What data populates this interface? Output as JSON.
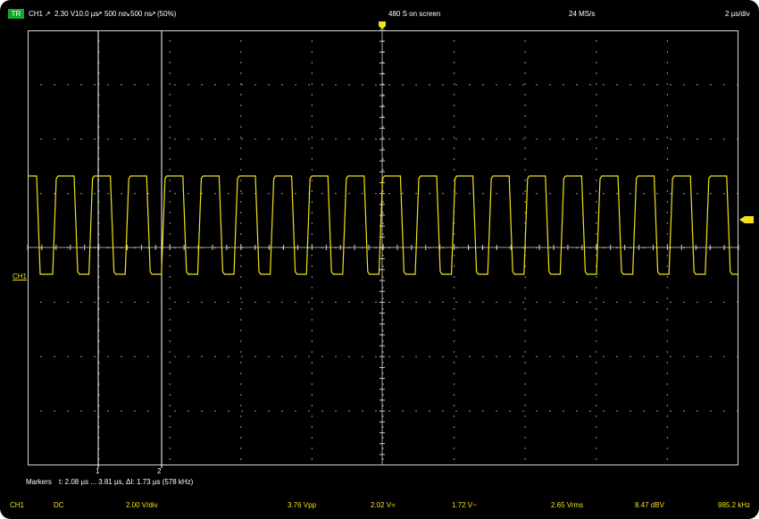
{
  "header": {
    "trigger_badge": "TR",
    "channel": "CH1",
    "trigger_level": "2.30 V",
    "timebase": "10.0 µs",
    "rise_time": "500 ns",
    "fall_time": "500 ns",
    "trigger_position": "(50%)",
    "samples_on_screen": "480 S on screen",
    "sample_rate": "24 MS/s",
    "time_per_div": "2 µs/div"
  },
  "trace": {
    "channel_label": "CH1",
    "color": "#f2e21a",
    "high_level_v": 3.3,
    "low_level_v": -0.45
  },
  "markers": {
    "label": "Markers",
    "readout": "t: 2.08 µs ... 3.81 µs,  ΔI: 1.73 µs (578 kHz)",
    "marker_1_label": "1",
    "marker_2_label": "2",
    "marker_1_time_us": 2.08,
    "marker_2_time_us": 3.81
  },
  "footer": {
    "channel": "CH1",
    "coupling": "DC",
    "volts_per_div": "2.00 V/div",
    "vpp": "3.76 Vpp",
    "v_mean": "2.02 V=",
    "v_ac": "1.72 V~",
    "vrms": "2.65 Vrms",
    "dbv": "8.47 dBV",
    "frequency": "985.2 kHz"
  },
  "colors": {
    "background": "#000000",
    "trace": "#f2e21a",
    "grid": "#d8d8d8",
    "trigger_badge": "#17a52c"
  }
}
